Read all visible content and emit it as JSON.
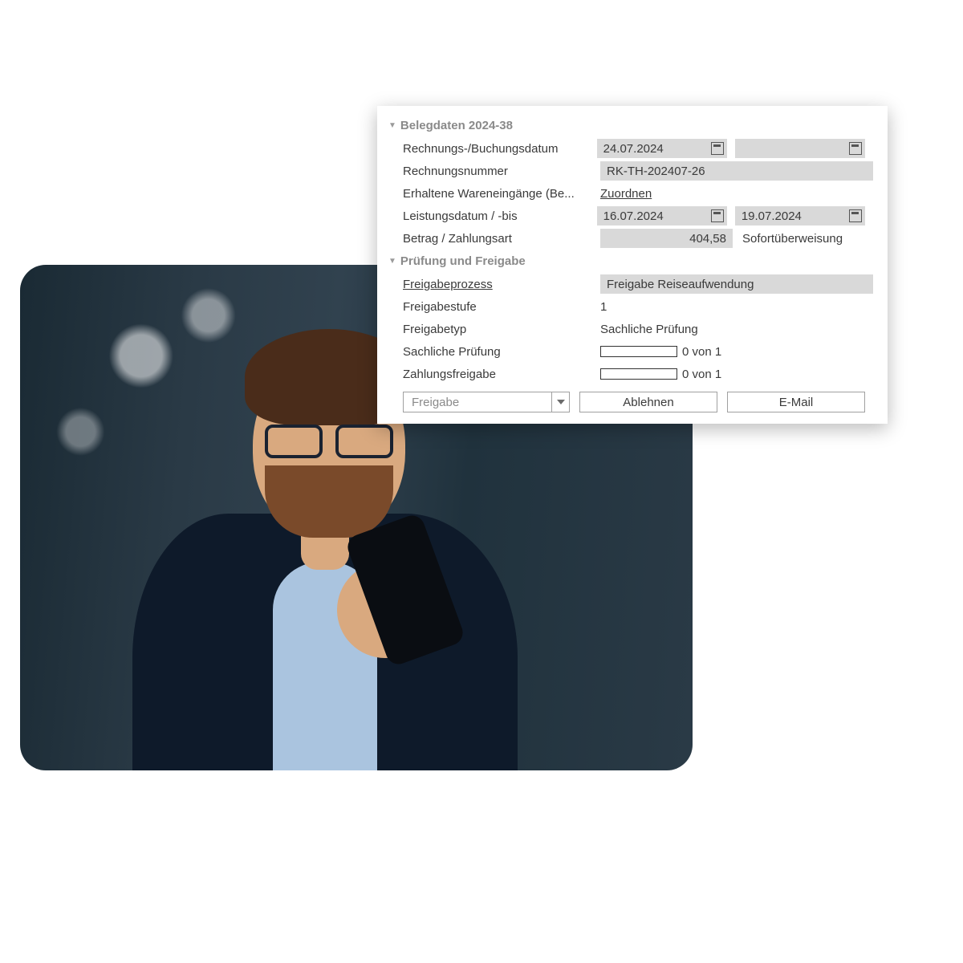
{
  "section1": {
    "title": "Belegdaten 2024-38",
    "rows": {
      "invoice_date_label": "Rechnungs-/Buchungsdatum",
      "invoice_date": "24.07.2024",
      "booking_date": "",
      "invoice_no_label": "Rechnungsnummer",
      "invoice_no": "RK-TH-202407-26",
      "goods_label": "Erhaltene Wareneingänge (Be...",
      "goods_link": "Zuordnen",
      "service_date_label": "Leistungsdatum / -bis",
      "service_from": "16.07.2024",
      "service_to": "19.07.2024",
      "amount_label": "Betrag / Zahlungsart",
      "amount": "404,58",
      "payment_method": "Sofortüberweisung"
    }
  },
  "section2": {
    "title": "Prüfung und Freigabe",
    "rows": {
      "process_label": "Freigabeprozess",
      "process_value": "Freigabe Reiseaufwendung",
      "level_label": "Freigabestufe",
      "level_value": "1",
      "type_label": "Freigabetyp",
      "type_value": "Sachliche Prüfung",
      "check_label": "Sachliche Prüfung",
      "check_progress": "0 von 1",
      "payment_label": "Zahlungsfreigabe",
      "payment_progress": "0 von 1"
    }
  },
  "actions": {
    "dropdown": "Freigabe",
    "reject": "Ablehnen",
    "email": "E-Mail"
  }
}
